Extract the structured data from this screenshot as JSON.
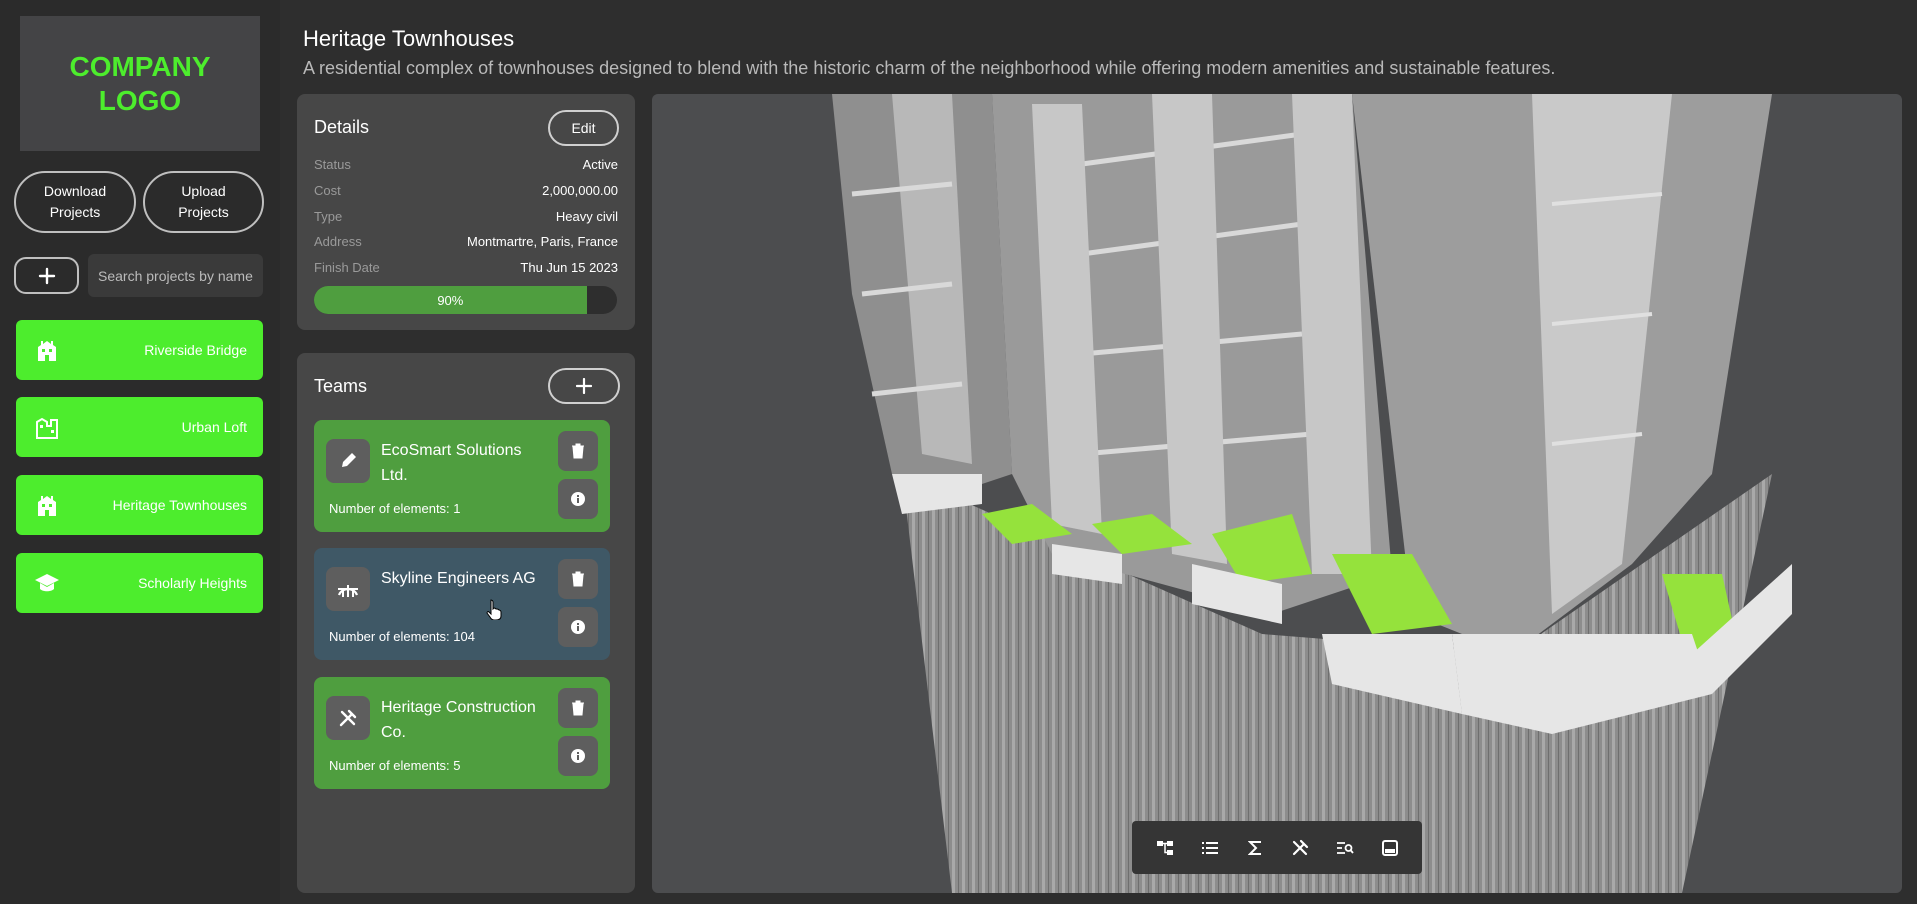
{
  "sidebar": {
    "logo_text": "COMPANY LOGO",
    "download_label": "Download Projects",
    "upload_label": "Upload Projects",
    "search_placeholder": "Search projects by name",
    "projects": [
      {
        "label": "Riverside Bridge",
        "icon": "building-icon"
      },
      {
        "label": "Urban Loft",
        "icon": "city-icon"
      },
      {
        "label": "Heritage Townhouses",
        "icon": "building-icon"
      },
      {
        "label": "Scholarly Heights",
        "icon": "graduation-cap-icon"
      }
    ],
    "accent": "#4ded2d"
  },
  "header": {
    "title": "Heritage Townhouses",
    "subtitle": "A residential complex of townhouses designed to blend with the historic charm of the neighborhood while offering modern amenities and sustainable features."
  },
  "details": {
    "title": "Details",
    "edit_label": "Edit",
    "rows": [
      {
        "key": "Status",
        "value": "Active"
      },
      {
        "key": "Cost",
        "value": "2,000,000.00"
      },
      {
        "key": "Type",
        "value": "Heavy civil"
      },
      {
        "key": "Address",
        "value": "Montmartre, Paris, France"
      },
      {
        "key": "Finish Date",
        "value": "Thu Jun 15 2023"
      }
    ],
    "progress_label": "90%",
    "progress": 0.9
  },
  "teams": {
    "title": "Teams",
    "items": [
      {
        "name": "EcoSmart Solutions Ltd.",
        "count": "Number of elements: 1",
        "icon": "pen-icon",
        "color": "#4f9e3f"
      },
      {
        "name": "Skyline Engineers AG",
        "count": "Number of elements: 104",
        "icon": "bridge-icon",
        "color": "#3f5866"
      },
      {
        "name": "Heritage Construction Co.",
        "count": "Number of elements: 5",
        "icon": "tools-icon",
        "color": "#4f9e3f"
      }
    ]
  },
  "toolbar": {
    "tools": [
      "tree-icon",
      "list-icon",
      "sigma-icon",
      "tools-icon",
      "search-list-icon",
      "inbox-icon"
    ]
  }
}
